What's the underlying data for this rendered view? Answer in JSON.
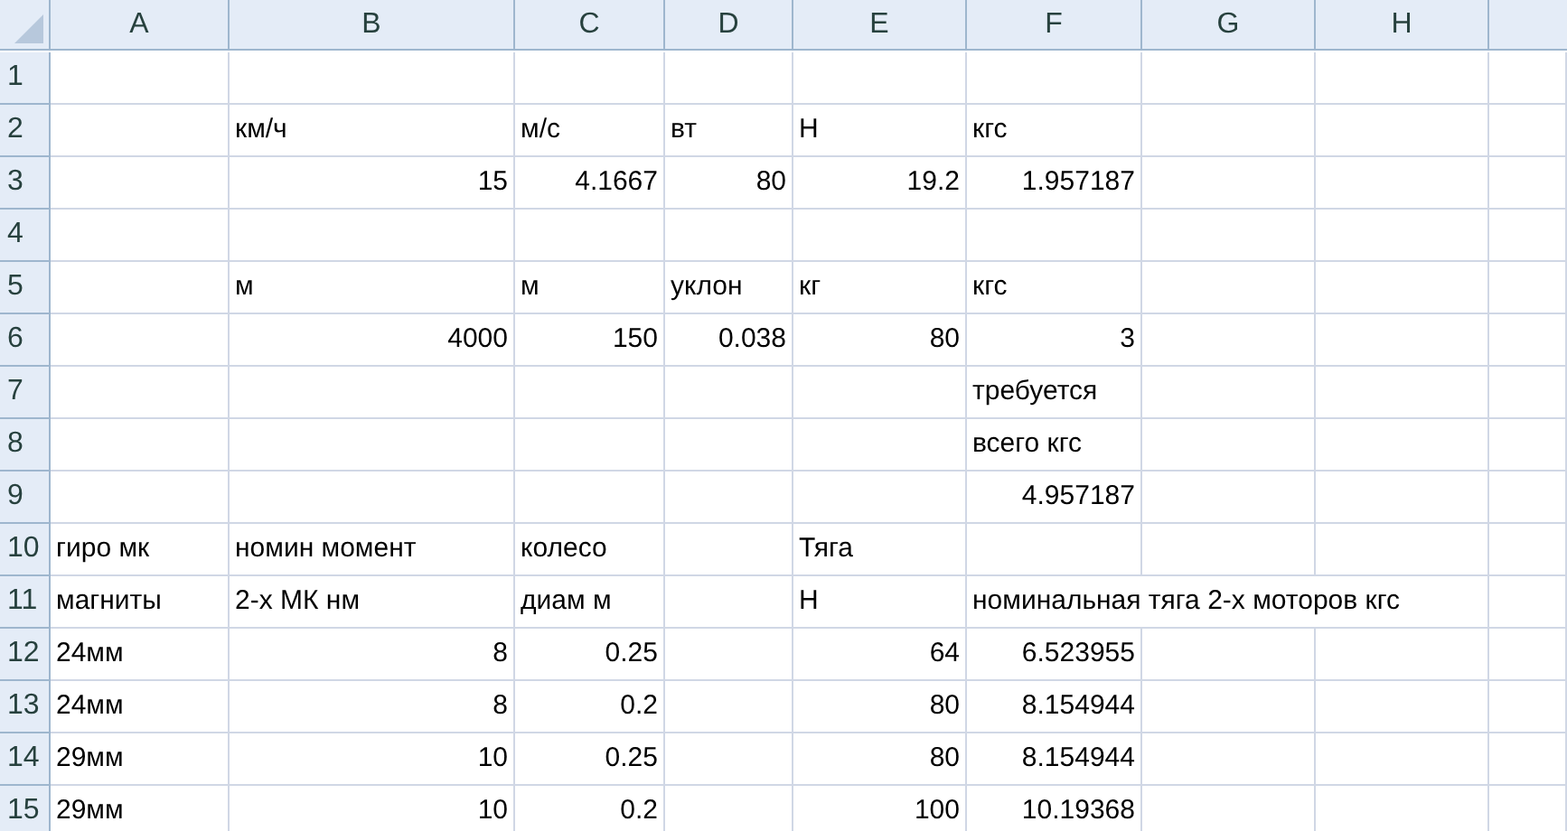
{
  "columns": [
    "A",
    "B",
    "C",
    "D",
    "E",
    "F",
    "G",
    "H"
  ],
  "rows": [
    {
      "number": "1",
      "cells": [
        null,
        null,
        null,
        null,
        null,
        null,
        null,
        null
      ]
    },
    {
      "number": "2",
      "cells": [
        null,
        {
          "text": "км/ч",
          "kind": "text"
        },
        {
          "text": "м/с",
          "kind": "text"
        },
        {
          "text": "вт",
          "kind": "text"
        },
        {
          "text": "Н",
          "kind": "text"
        },
        {
          "text": "кгс",
          "kind": "text"
        },
        null,
        null
      ]
    },
    {
      "number": "3",
      "cells": [
        null,
        {
          "text": "15",
          "kind": "number"
        },
        {
          "text": "4.1667",
          "kind": "number"
        },
        {
          "text": "80",
          "kind": "number"
        },
        {
          "text": "19.2",
          "kind": "number"
        },
        {
          "text": "1.957187",
          "kind": "number"
        },
        null,
        null
      ]
    },
    {
      "number": "4",
      "cells": [
        null,
        null,
        null,
        null,
        null,
        null,
        null,
        null
      ]
    },
    {
      "number": "5",
      "cells": [
        null,
        {
          "text": "м",
          "kind": "text"
        },
        {
          "text": "м",
          "kind": "text"
        },
        {
          "text": "уклон",
          "kind": "text"
        },
        {
          "text": "кг",
          "kind": "text"
        },
        {
          "text": "кгс",
          "kind": "text"
        },
        null,
        null
      ]
    },
    {
      "number": "6",
      "cells": [
        null,
        {
          "text": "4000",
          "kind": "number"
        },
        {
          "text": "150",
          "kind": "number"
        },
        {
          "text": "0.038",
          "kind": "number"
        },
        {
          "text": "80",
          "kind": "number"
        },
        {
          "text": "3",
          "kind": "number"
        },
        null,
        null
      ]
    },
    {
      "number": "7",
      "cells": [
        null,
        null,
        null,
        null,
        null,
        {
          "text": "требуется",
          "kind": "text"
        },
        null,
        null
      ]
    },
    {
      "number": "8",
      "cells": [
        null,
        null,
        null,
        null,
        null,
        {
          "text": "всего кгс",
          "kind": "text"
        },
        null,
        null
      ]
    },
    {
      "number": "9",
      "cells": [
        null,
        null,
        null,
        null,
        null,
        {
          "text": "4.957187",
          "kind": "number"
        },
        null,
        null
      ]
    },
    {
      "number": "10",
      "cells": [
        {
          "text": "гиро мк",
          "kind": "text"
        },
        {
          "text": "номин момент",
          "kind": "text"
        },
        {
          "text": "колесо",
          "kind": "text"
        },
        null,
        {
          "text": "Тяга",
          "kind": "text"
        },
        null,
        null,
        null
      ]
    },
    {
      "number": "11",
      "cells": [
        {
          "text": "магниты",
          "kind": "text"
        },
        {
          "text": "2-х МК нм",
          "kind": "text"
        },
        {
          "text": "диам м",
          "kind": "text"
        },
        null,
        {
          "text": "Н",
          "kind": "text"
        },
        {
          "text": "номинальная тяга 2-х моторов кгс",
          "kind": "text"
        },
        null,
        null
      ]
    },
    {
      "number": "12",
      "cells": [
        {
          "text": "24мм",
          "kind": "text"
        },
        {
          "text": "8",
          "kind": "number"
        },
        {
          "text": "0.25",
          "kind": "number"
        },
        null,
        {
          "text": "64",
          "kind": "number"
        },
        {
          "text": "6.523955",
          "kind": "number"
        },
        null,
        null
      ]
    },
    {
      "number": "13",
      "cells": [
        {
          "text": "24мм",
          "kind": "text"
        },
        {
          "text": "8",
          "kind": "number"
        },
        {
          "text": "0.2",
          "kind": "number"
        },
        null,
        {
          "text": "80",
          "kind": "number"
        },
        {
          "text": "8.154944",
          "kind": "number"
        },
        null,
        null
      ]
    },
    {
      "number": "14",
      "cells": [
        {
          "text": "29мм",
          "kind": "text"
        },
        {
          "text": "10",
          "kind": "number"
        },
        {
          "text": "0.25",
          "kind": "number"
        },
        null,
        {
          "text": "80",
          "kind": "number"
        },
        {
          "text": "8.154944",
          "kind": "number"
        },
        null,
        null
      ]
    },
    {
      "number": "15",
      "cells": [
        {
          "text": "29мм",
          "kind": "text"
        },
        {
          "text": "10",
          "kind": "number"
        },
        {
          "text": "0.2",
          "kind": "number"
        },
        null,
        {
          "text": "100",
          "kind": "number"
        },
        {
          "text": "10.19368",
          "kind": "number"
        },
        null,
        null
      ]
    }
  ]
}
